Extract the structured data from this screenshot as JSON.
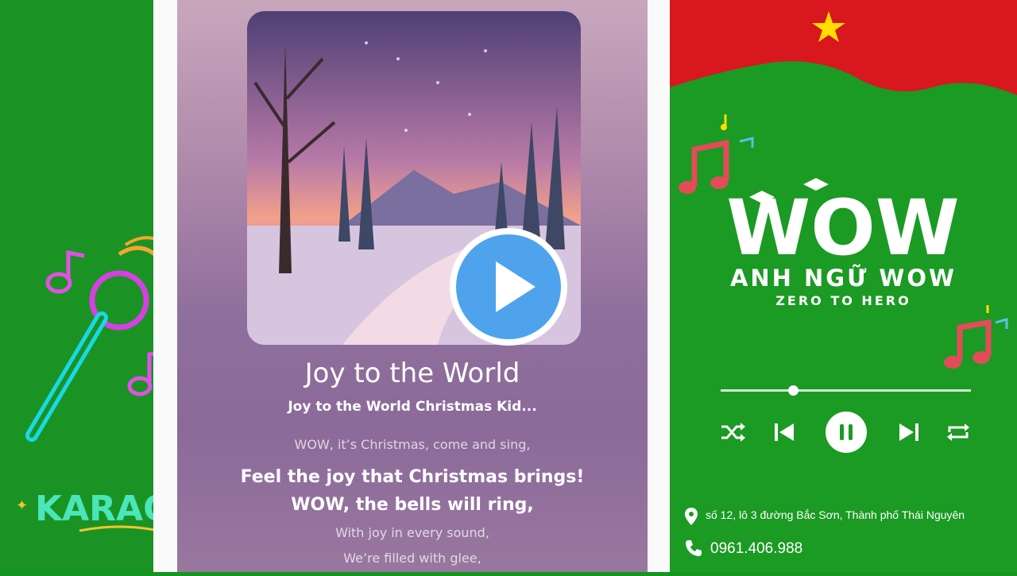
{
  "left_panel": {
    "karaoke_text": "KARAOKÊ"
  },
  "player": {
    "song_title": "Joy to the World",
    "song_subtitle": "Joy to the World Christmas Kid...",
    "lyrics": [
      "WOW, it’s Christmas, come and sing,",
      "Feel the joy that Christmas brings!",
      "WOW, the bells will ring,",
      "With joy in every sound,",
      "We’re filled with glee,"
    ],
    "play_button_icon": "play-icon"
  },
  "brand": {
    "logo_text": "WOW",
    "name": "ANH NGỮ WOW",
    "tagline": "ZERO TO HERO",
    "progress_fraction": 0.29,
    "controls": [
      "shuffle-icon",
      "previous-icon",
      "pause-icon",
      "next-icon",
      "repeat-icon"
    ],
    "address": "số 12, lô 3 đường Bắc Sơn, Thành phố Thái Nguyên",
    "phone": "0961.406.988",
    "colors": {
      "green": "#1b9a24",
      "red": "#d8171e",
      "star": "#ffde00",
      "play_blue": "#4ea3ec"
    }
  }
}
